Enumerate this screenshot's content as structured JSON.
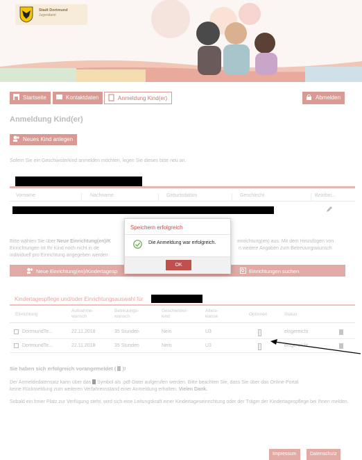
{
  "brand": {
    "title": "Stadt Dortmund",
    "subtitle": "Jugendamt"
  },
  "nav": {
    "start": "Startseite",
    "contact": "Kontaktdaten",
    "registration": "Anmeldung Kind(er)",
    "logout": "Abmelden"
  },
  "page": {
    "title": "Anmeldung Kind(er)",
    "new_child_button": "Neues Kind anlegen",
    "sibling_note": "Sofern Sie ein Geschwisterkind anmelden möchten, legen Sie dieses bitte neu an."
  },
  "children_table": {
    "columns": [
      "Vorname",
      "Nachname",
      "Geburtsdatum",
      "Geschlecht",
      "Bearbei..."
    ]
  },
  "institution_note": {
    "part1": "Bitte wählen Sie über ",
    "bold": "Neue Einrichtung(en)/K",
    "part2": " einrichtung(en) aus. Mit dem Hinzufügen von",
    "line2a": "Einrichtungen ist Ihr Kind noch nicht in de",
    "line2b": "n weitere Angaben zum Betreuungswunsch",
    "line3": "individuell pro Einrichtung angegeben werden"
  },
  "actions": {
    "new_institution": "Neue Einrichtung(en)/Kindertagesp",
    "search": "Einrichtungen suchen"
  },
  "modal": {
    "title": "Speichern erfolgreich",
    "message": "Die Anmeldung war erfolgreich.",
    "ok": "OK"
  },
  "selection": {
    "heading": "Kindertagespflege und/oder Einrichtungsauswahl für",
    "columns": {
      "einrichtung": "Einrichtung",
      "aufnahme": "Aufnahme-\nwunsch",
      "betreuung": "Betreuungs-\nwunsch",
      "geschwister": "Geschwister-\nkind",
      "alter": "Alters-\nklasse",
      "optionen": "Optionen",
      "status": "Status"
    },
    "rows": [
      {
        "einrichtung": "DortmundTe...",
        "aufnahme": "22.11.2018",
        "betreuung": "35 Stunden",
        "geschwister": "Nein",
        "alter": "U3",
        "status": "eingereicht"
      },
      {
        "einrichtung": "DortmundTe...",
        "aufnahme": "22.11.2018",
        "betreuung": "35 Stunden",
        "geschwister": "Nein",
        "alter": "U3",
        "status": "eingereicht"
      }
    ]
  },
  "confirmation": {
    "title": "Sie haben sich erfolgreich vorangemeldet ( ",
    "title_end": " )!",
    "p1_a": "Der Anmeldedatensatz kann über das ",
    "p1_b": " Symbol als .pdf-Datei aufgerufen werden. Bitte beachten Sie, dass Sie über das Online-Portal",
    "p1_c": "keine Rückmeldung zum weiteren Verfahrensstand einer Anmeldung erhalten. ",
    "p1_thanks": "Vielen Dank.",
    "p2": "Sobald ein freier Platz zur Verfügung steht, wird sich eine Leitungskraft einer Kindertageseinrichtung oder der Träger der Kindertagespflege bei Ihnen melden."
  },
  "footer": {
    "impressum": "Impressum",
    "datenschutz": "Datenschutz"
  },
  "colors": {
    "accent": "#d99a93",
    "modal_title": "#c0504d",
    "ok_button": "#c0504d"
  }
}
